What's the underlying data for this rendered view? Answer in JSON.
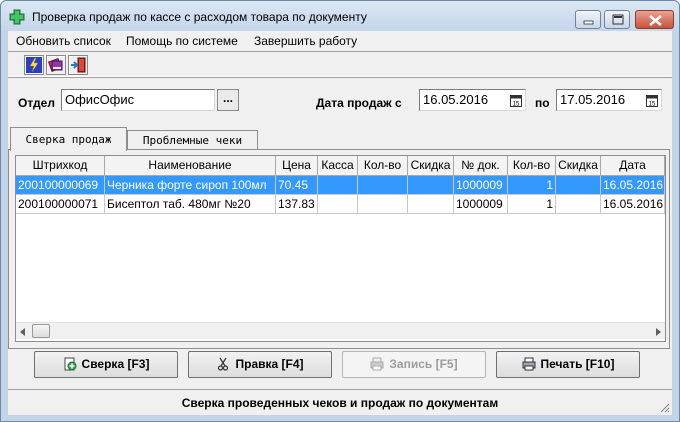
{
  "window": {
    "title": "Проверка продаж по кассе с расходом товара по документу",
    "icon": "green-cross-icon"
  },
  "menu": {
    "items": [
      {
        "label": "Обновить список"
      },
      {
        "label": "Помощь по системе"
      },
      {
        "label": "Завершить работу"
      }
    ]
  },
  "toolbar": {
    "icons": [
      "lightning-refresh-icon",
      "books-help-icon",
      "exit-door-icon"
    ]
  },
  "filter": {
    "dept_label": "Отдел",
    "dept_value": "ОфисОфис",
    "browse_label": "...",
    "date_from_label": "Дата продаж с",
    "date_from": "16.05.2016",
    "date_to_label": "по",
    "date_to": "17.05.2016",
    "calendar_icon_text": "15"
  },
  "tabs": [
    {
      "label": "Сверка продаж",
      "active": true
    },
    {
      "label": "Проблемные чеки",
      "active": false
    }
  ],
  "grid": {
    "columns": [
      "Штрихкод",
      "Наименование",
      "Цена",
      "Касса",
      "Кол-во",
      "Скидка",
      "№ док.",
      "Кол-во",
      "Скидка",
      "Дата"
    ],
    "rows": [
      [
        "200100000069",
        "Черника форте сироп 100мл",
        "70.45",
        "",
        "",
        "",
        "1000009",
        "1",
        "",
        "16.05.2016"
      ],
      [
        "200100000071",
        "Бисептол таб. 480мг №20",
        "137.83",
        "",
        "",
        "",
        "1000009",
        "1",
        "",
        "16.05.2016"
      ]
    ],
    "selected_row": 0,
    "selected_color": "#3399ff"
  },
  "buttons": {
    "check": "Сверка [F3]",
    "edit": "Правка [F4]",
    "save": "Запись [F5]",
    "print": "Печать [F10]"
  },
  "status": {
    "text": "Сверка проведенных чеков и продаж по документам"
  }
}
